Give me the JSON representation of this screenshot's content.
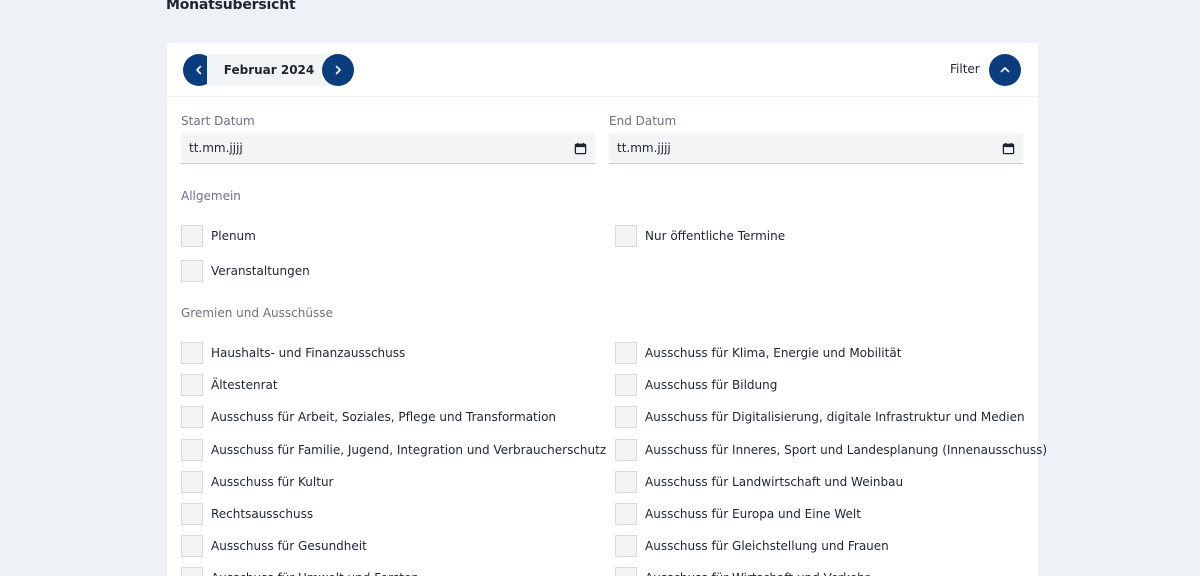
{
  "page": {
    "title": "Monatsübersicht"
  },
  "nav": {
    "month": "Februar 2024",
    "filter_label": "Filter",
    "prev_icon": "chevron-left-icon",
    "next_icon": "chevron-right-icon",
    "filter_icon": "chevron-up-icon"
  },
  "dates": {
    "start_label": "Start Datum",
    "start_placeholder": "tt.mm.jjjj",
    "end_label": "End Datum",
    "end_placeholder": "tt.mm.jjjj"
  },
  "allgemein": {
    "title": "Allgemein",
    "items": [
      "Plenum",
      "Nur öffentliche Termine",
      "Veranstaltungen"
    ]
  },
  "gremien": {
    "title": "Gremien und Ausschüsse",
    "left": [
      "Haushalts- und Finanzausschuss",
      "Ältestenrat",
      "Ausschuss für Arbeit, Soziales, Pflege und Transformation",
      "Ausschuss für Familie, Jugend, Integration und Verbraucherschutz",
      "Ausschuss für Kultur",
      "Rechtsausschuss",
      "Ausschuss für Gesundheit",
      "Ausschuss für Umwelt und Forsten"
    ],
    "right": [
      "Ausschuss für Klima, Energie und Mobilität",
      "Ausschuss für Bildung",
      "Ausschuss für Digitalisierung, digitale Infrastruktur und Medien",
      "Ausschuss für Inneres, Sport und Landesplanung (Innenausschuss)",
      "Ausschuss für Landwirtschaft und Weinbau",
      "Ausschuss für Europa und Eine Welt",
      "Ausschuss für Gleichstellung und Frauen",
      "Ausschuss für Wirtschaft und Verkehr"
    ]
  },
  "colors": {
    "accent": "#0b3c7d",
    "background": "#eef2f7"
  }
}
